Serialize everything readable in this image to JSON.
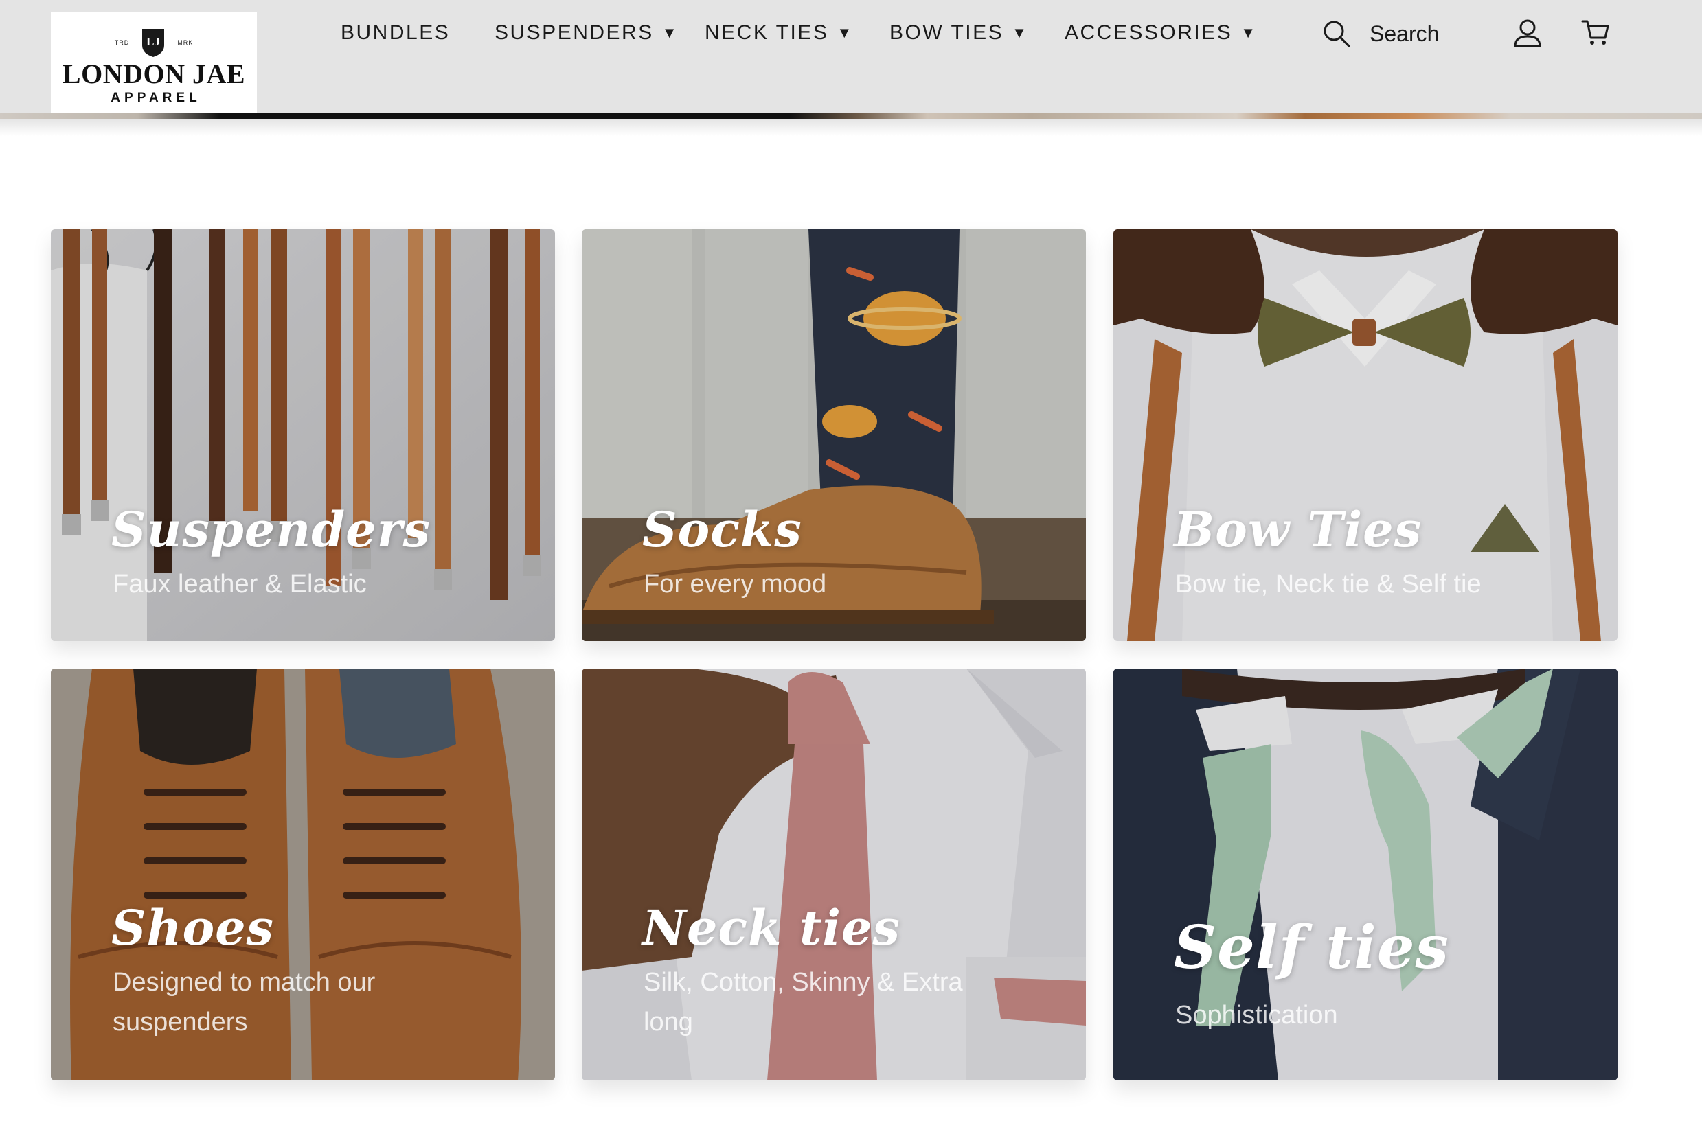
{
  "brand": {
    "name": "LONDON JAE",
    "sub": "APPAREL",
    "mark_left": "TRD",
    "mark_right": "MRK",
    "monogram": "LJ"
  },
  "nav": {
    "items": [
      {
        "label": "BUNDLES",
        "has_dropdown": false
      },
      {
        "label": "SUSPENDERS",
        "has_dropdown": true
      },
      {
        "label": "NECK TIES",
        "has_dropdown": true
      },
      {
        "label": "BOW TIES",
        "has_dropdown": true
      },
      {
        "label": "ACCESSORIES",
        "has_dropdown": true
      }
    ],
    "caret": "▼",
    "search_label": "Search",
    "icons": [
      "search-icon",
      "account-icon",
      "cart-icon"
    ]
  },
  "categories": [
    {
      "title": "Suspenders",
      "subtitle": "Faux leather & Elastic"
    },
    {
      "title": "Socks",
      "subtitle": "For every mood"
    },
    {
      "title": "Bow Ties",
      "subtitle": "Bow tie, Neck tie & Self tie"
    },
    {
      "title": "Shoes",
      "subtitle": "Designed to match our suspenders"
    },
    {
      "title": "Neck ties",
      "subtitle": "Silk, Cotton, Skinny & Extra long"
    },
    {
      "title": "Self ties",
      "subtitle": "Sophistication"
    }
  ],
  "colors": {
    "header_bg": "#e4e4e4",
    "text": "#1a1a1a",
    "card_title": "#ffffff"
  }
}
